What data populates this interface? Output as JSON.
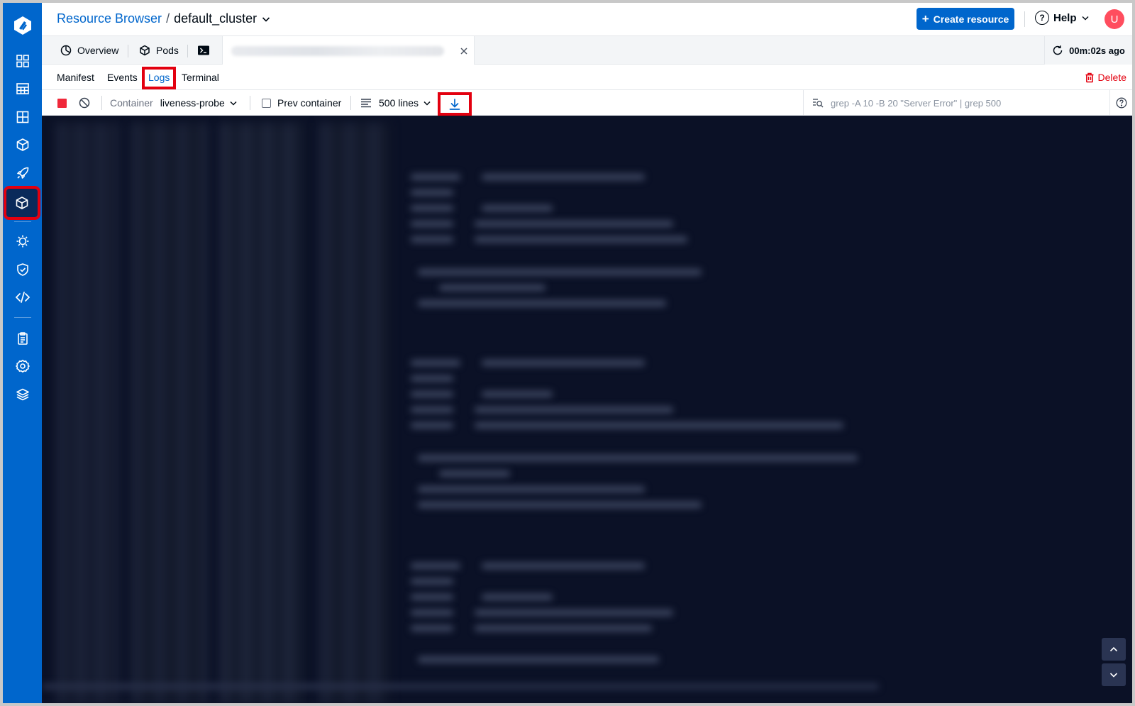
{
  "header": {
    "breadcrumb_link": "Resource Browser",
    "breadcrumb_separator": "/",
    "cluster_name": "default_cluster",
    "create_button": "Create resource",
    "help_label": "Help",
    "avatar_initial": "U"
  },
  "tabs": {
    "overview": "Overview",
    "pods": "Pods",
    "refresh_text": "00m:02s ago"
  },
  "subtabs": {
    "manifest": "Manifest",
    "events": "Events",
    "logs": "Logs",
    "terminal": "Terminal",
    "delete": "Delete"
  },
  "toolbar": {
    "container_label": "Container",
    "container_value": "liveness-probe",
    "prev_container": "Prev container",
    "lines": "500 lines",
    "search_placeholder": "grep -A 10 -B 20 \"Server Error\" | grep 500"
  },
  "sidebar": {
    "icons": [
      "apps-grid-icon",
      "table-icon",
      "grid-icon",
      "cube-icon",
      "rocket-icon",
      "resource-browser-icon",
      "bug-icon",
      "shield-icon",
      "code-icon",
      "clipboard-icon",
      "settings-icon",
      "layers-icon"
    ],
    "active": "resource-browser-icon"
  },
  "colors": {
    "brand": "#0066cc",
    "highlight": "#e3000f",
    "log_background": "#0b1126",
    "danger": "#e3000f"
  }
}
